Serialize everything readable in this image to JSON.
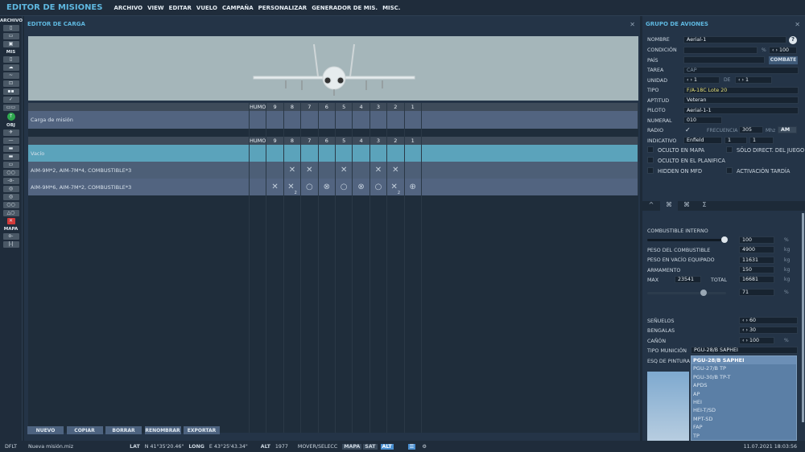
{
  "app_title": "EDITOR DE MISIONES",
  "menu": [
    "ARCHIVO",
    "VIEW",
    "EDITAR",
    "VUELO",
    "CAMPAÑA",
    "PERSONALIZAR",
    "GENERADOR DE MIS.",
    "MISC."
  ],
  "toolbar": {
    "sections": {
      "archivo": "ARCHIVO",
      "mis": "MIS",
      "obj": "OBJ",
      "mapa": "MAPA"
    },
    "icons": {
      "archivo": [
        "new-file-icon",
        "open-folder-icon",
        "save-icon"
      ],
      "mis": [
        "briefing-icon",
        "weather-icon",
        "route-icon",
        "trigger-icon",
        "goals-icon",
        "check-icon",
        "flights-icon",
        "green-up-icon"
      ],
      "obj": [
        "aircraft-icon",
        "helicopter-icon",
        "ship-icon",
        "vehicle-icon",
        "static-icon",
        "template-icon",
        "waypoint-icon",
        "zone-icon",
        "nav-target-icon",
        "airfield-icon",
        "formation-icon",
        "delete-icon"
      ],
      "mapa": [
        "map-key-icon",
        "ruler-icon"
      ]
    },
    "glyphs": {
      "archivo": [
        "▯",
        "▭",
        "▣"
      ],
      "mis": [
        "▯",
        "☁",
        "~",
        "⊡",
        "▪▪",
        "✓",
        "▭▭",
        "↑"
      ],
      "obj": [
        "✈",
        "—",
        "▬",
        "▬",
        "▭",
        "○○",
        "-o-",
        "◎",
        "◎",
        "○○",
        "△○",
        "✕"
      ],
      "mapa": [
        "o-",
        "|-|"
      ]
    }
  },
  "loadout": {
    "title": "EDITOR DE CARGA",
    "columns": [
      "HUMO",
      "9",
      "8",
      "7",
      "6",
      "5",
      "4",
      "3",
      "2",
      "1"
    ],
    "mission_row": "Carga de misión",
    "rows": [
      {
        "label": "Vacío",
        "selected": true,
        "cells": [
          "",
          "",
          "",
          "",
          "",
          "",
          "",
          "",
          "",
          ""
        ]
      },
      {
        "label": "AIM-9M*2, AIM-7M*4, COMBUSTIBLE*3",
        "cells": [
          "",
          "",
          "✕",
          "✕",
          "",
          "✕",
          "",
          "✕",
          "✕",
          ""
        ]
      },
      {
        "label": "AIM-9M*6, AIM-7M*2, COMBUSTIBLE*3",
        "cells": [
          "",
          "✕",
          "✕",
          "○",
          "⊗",
          "○",
          "⊗",
          "○",
          "✕",
          "⊕"
        ],
        "counts": [
          "",
          "",
          "2",
          "",
          "",
          "",
          "",
          "",
          "2",
          ""
        ]
      }
    ],
    "buttons": [
      "NUEVO",
      "COPIAR",
      "BORRAR",
      "RENOMBRAR",
      "EXPORTAR"
    ]
  },
  "group": {
    "title": "GRUPO DE AVIONES",
    "labels": {
      "name": "NOMBRE",
      "condition": "CONDICIÓN",
      "country": "PAÍS",
      "task": "TAREA",
      "unit": "UNIDAD",
      "of": "DE",
      "type": "TIPO",
      "skill": "APTITUD",
      "pilot": "PILOTO",
      "numeral": "NUMERAL",
      "radio": "RADIO",
      "frequency": "FRECUENCIA",
      "callsign": "INDICATIVO"
    },
    "values": {
      "name": "Aerial-1",
      "condition_pct": "%",
      "condition": "100",
      "country": "",
      "task": "CAP",
      "unit": "1",
      "unit_of": "1",
      "type": "F/A-18C Lote 20",
      "skill": "Veteran",
      "pilot": "Aerial-1-1",
      "numeral": "010",
      "radio_checked": "✓",
      "frequency": "305",
      "freq_unit": "Mhz",
      "modulation": "AM",
      "callsign": "Enfield",
      "callsign_n1": "1",
      "callsign_n2": "1"
    },
    "combat_button": "COMBATE",
    "help": "?",
    "checkboxes": [
      "OCULTO EN MAPA",
      "SÓLO DIRECT. DEL JUEGO",
      "OCULTO EN EL PLANIFICA",
      "HIDDEN ON MFD",
      "ACTIVACIÓN TARDÍA"
    ]
  },
  "payload": {
    "tabs": [
      "^",
      "⌘",
      "⌘",
      "Σ"
    ],
    "fuel_label": "COMBUSTIBLE INTERNO",
    "fuel_pct": 100,
    "fuel_pct_text": "100",
    "fuel_weight_label": "PESO DEL COMBUSTIBLE",
    "fuel_weight": "4900",
    "empty_label": "PESO EN VACÍO EQUIPADO",
    "empty": "11631",
    "weapons_label": "ARMAMENTO",
    "weapons": "150",
    "max_label": "MAX",
    "max": "23541",
    "total_label": "TOTAL",
    "total": "16681",
    "load_pct": 71,
    "load_pct_text": "71",
    "chaff_label": "SEÑUELOS",
    "chaff": "60",
    "flares_label": "BENGALAS",
    "flares": "30",
    "gun_label": "CAÑÓN",
    "gun": "100",
    "ammo_label": "TIPO MUNICIÓN",
    "ammo": "PGU-28/B SAPHEI",
    "paint_label": "ESQ DE PINTURA",
    "pct": "%",
    "kg": "kg",
    "ammo_options": [
      "PGU-28/B SAPHEI",
      "PGU-27/B TP",
      "PGU-30/B TP-T",
      "APDS",
      "AP",
      "HEI",
      "HEI-T/SD",
      "MPT-SD",
      "FAP",
      "TP"
    ]
  },
  "status": {
    "profile": "DFLT",
    "file": "Nueva misión.miz",
    "lat_label": "LAT",
    "lat": "N 41°35'20.46\"",
    "long_label": "LONG",
    "long": "E 43°25'43.34\"",
    "alt_label": "ALT",
    "alt": "1977",
    "mode": "MOVER/SELECC",
    "map": "MAPA",
    "sat": "SAT",
    "alt_btn": "ALT",
    "datetime": "11.07.2021 18:03:56"
  }
}
